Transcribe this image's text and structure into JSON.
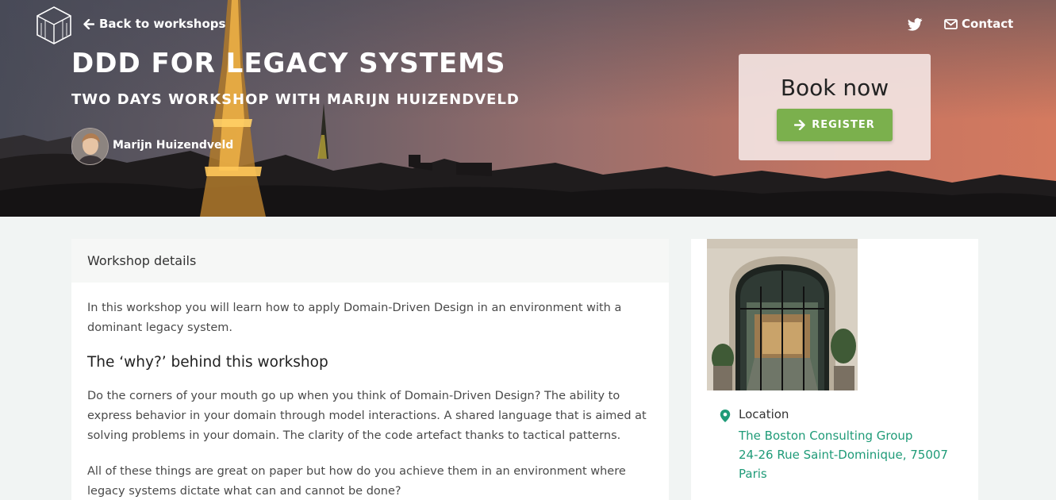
{
  "header": {
    "back_label": "Back to workshops",
    "contact_label": "Contact",
    "title": "DDD FOR LEGACY SYSTEMS",
    "subtitle": "TWO DAYS WORKSHOP WITH MARIJN HUIZENDVELD",
    "speaker_name": "Marijn Huizendveld"
  },
  "booking": {
    "title": "Book now",
    "register_label": "REGISTER",
    "button_color": "#7bb04d"
  },
  "details": {
    "heading": "Workshop details",
    "intro": "In this workshop you will learn how to apply Domain-Driven Design in an environment with a dominant legacy system.",
    "why_heading": "The ‘why?’ behind this workshop",
    "paragraph1": "Do the corners of your mouth go up when you think of Domain-Driven Design? The ability to express behavior in your domain through model interactions. A shared language that is aimed at solving problems in your domain. The clarity of the code artefact thanks to tactical patterns.",
    "paragraph2": "All of these things are great on paper but how do you achieve them in an environment where legacy systems dictate what can and cannot be done?"
  },
  "location": {
    "label": "Location",
    "venue": "The Boston Consulting Group",
    "street": "24-26 Rue Saint-Dominique, 75007",
    "city": "Paris",
    "link_color": "#1f9b78"
  },
  "icons": [
    "logo-icon",
    "arrow-left-icon",
    "twitter-icon",
    "envelope-icon",
    "arrow-right-icon",
    "map-pin-icon"
  ]
}
